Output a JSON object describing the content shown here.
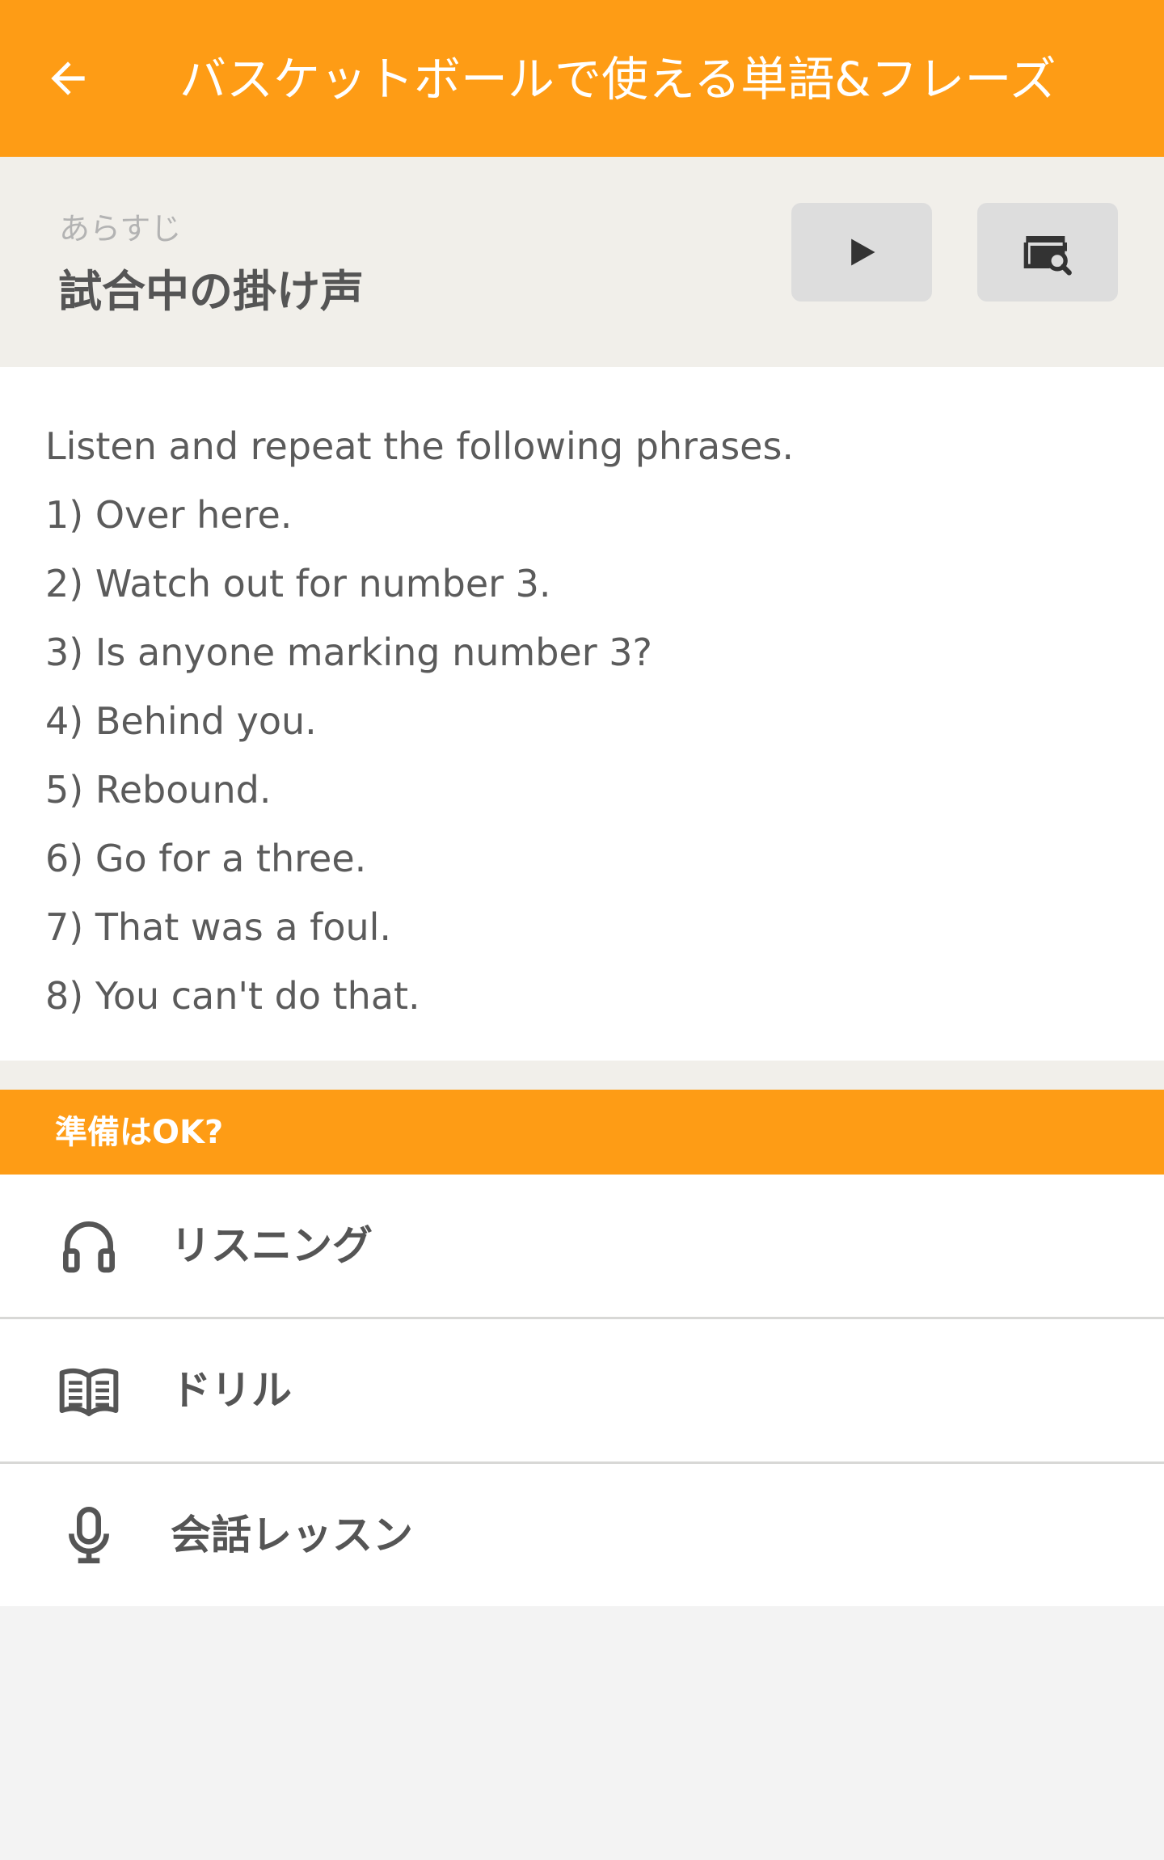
{
  "app_bar": {
    "title": "バスケットボールで使える単語&フレーズ"
  },
  "summary": {
    "label": "あらすじ",
    "title": "試合中の掛け声"
  },
  "content": {
    "lines": [
      "Listen and repeat the following phrases.",
      "1) Over here.",
      "2) Watch out for number 3.",
      "3) Is anyone marking number 3?",
      "4) Behind you.",
      "5) Rebound.",
      "6) Go for a three.",
      "7) That was a foul.",
      "8) You can't do that."
    ]
  },
  "section": {
    "header": "準備はOK?"
  },
  "menu": [
    {
      "label": "リスニング",
      "icon": "headphones-icon"
    },
    {
      "label": "ドリル",
      "icon": "book-icon"
    },
    {
      "label": "会話レッスン",
      "icon": "microphone-icon"
    }
  ],
  "colors": {
    "accent": "#fe9c15",
    "summary_bg": "#f1efea",
    "button_bg": "#dddddd"
  }
}
